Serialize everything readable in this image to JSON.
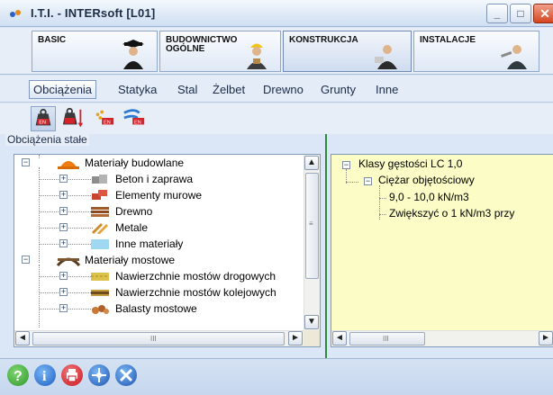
{
  "window": {
    "title": "I.T.I. - INTERsoft [L01]",
    "controls": {
      "minimize": "_",
      "maximize": "□",
      "close": "✕"
    }
  },
  "modules": [
    {
      "label": "BASIC",
      "icon": "graduate-figure-icon"
    },
    {
      "label": "BUDOWNICTWO\nOGÓLNE",
      "icon": "construction-worker-icon"
    },
    {
      "label": "KONSTRUKCJA",
      "icon": "engineer-figure-icon",
      "active": true
    },
    {
      "label": "INSTALACJE",
      "icon": "plumber-figure-icon"
    }
  ],
  "tabs": [
    "Obciążenia",
    "Statyka",
    "Stal",
    "Żelbet",
    "Drewno",
    "Grunty",
    "Inne"
  ],
  "selected_tab": "Obciążenia",
  "toolbar": [
    {
      "icon": "en-weight-icon",
      "pressed": true
    },
    {
      "icon": "en-weight-arrow-icon"
    },
    {
      "icon": "en-snow-icon"
    },
    {
      "icon": "en-wind-icon"
    }
  ],
  "group_label": "Obciążenia stałe",
  "left_tree": [
    {
      "label": "Materiały budowlane",
      "level": 0,
      "expander": "−",
      "icon": "hardhat-icon"
    },
    {
      "label": "Beton i zaprawa",
      "level": 1,
      "expander": "+",
      "icon": "concrete-blocks-icon"
    },
    {
      "label": "Elementy murowe",
      "level": 1,
      "expander": "+",
      "icon": "bricks-icon"
    },
    {
      "label": "Drewno",
      "level": 1,
      "expander": "+",
      "icon": "wood-planks-icon"
    },
    {
      "label": "Metale",
      "level": 1,
      "expander": "+",
      "icon": "metal-bars-icon"
    },
    {
      "label": "Inne materiały",
      "level": 1,
      "expander": "+",
      "icon": "other-materials-icon"
    },
    {
      "label": "Materiały mostowe",
      "level": 0,
      "expander": "−",
      "icon": "bridge-icon"
    },
    {
      "label": "Nawierzchnie mostów drogowych",
      "level": 1,
      "expander": "+",
      "icon": "road-surface-icon"
    },
    {
      "label": "Nawierzchnie mostów kolejowych",
      "level": 1,
      "expander": "+",
      "icon": "rail-track-icon"
    },
    {
      "label": "Balasty mostowe",
      "level": 1,
      "expander": "+",
      "icon": "ballast-icon"
    }
  ],
  "right_tree": [
    {
      "label": "Klasy gęstości LC 1,0",
      "level": 0,
      "expander": "−"
    },
    {
      "label": "Ciężar objętościowy",
      "level": 1,
      "expander": "−"
    },
    {
      "label": "9,0 - 10,0 kN/m3",
      "level": 2
    },
    {
      "label": "Zwiększyć o 1 kN/m3 przy",
      "level": 2
    }
  ],
  "scroll_glyphs": {
    "up": "▲",
    "down": "▼",
    "left": "◄",
    "right": "►",
    "grip_v": "≡",
    "grip_h": "III"
  },
  "status_buttons": [
    {
      "icon": "help-icon",
      "glyph": "?",
      "color": "#3aa63a"
    },
    {
      "icon": "info-icon",
      "glyph": "i",
      "color": "#1e6fd0"
    },
    {
      "icon": "print-icon",
      "glyph": "⎙",
      "color": "#d4222a"
    },
    {
      "icon": "network-icon",
      "glyph": "✥",
      "color": "#2460b8"
    },
    {
      "icon": "tools-icon",
      "glyph": "⚒",
      "color": "#2460b8"
    }
  ],
  "colors": {
    "accent_green": "#2e8b3a",
    "tree_background_right": "#fbfcc6"
  }
}
